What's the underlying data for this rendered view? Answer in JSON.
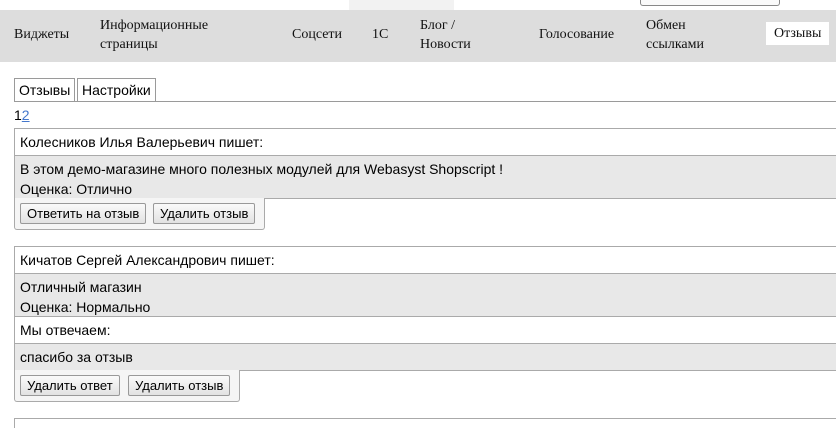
{
  "nav": {
    "items": [
      {
        "label1": "Виджеты",
        "label2": ""
      },
      {
        "label1": "Информационные",
        "label2": "страницы"
      },
      {
        "label1": "Соцсети",
        "label2": ""
      },
      {
        "label1": "1С",
        "label2": ""
      },
      {
        "label1": "Блог /",
        "label2": "Новости"
      },
      {
        "label1": "Голосование",
        "label2": ""
      },
      {
        "label1": "Обмен",
        "label2": "ссылками"
      },
      {
        "label1": "Отзывы",
        "label2": ""
      }
    ],
    "active_index": 7
  },
  "subtabs": [
    "Отзывы",
    "Настройки"
  ],
  "pager": {
    "current": "1",
    "other": "2"
  },
  "reviews": [
    {
      "header": "Колесников Илья Валерьевич пишет:",
      "text": "В этом демо-магазине много полезных модулей для Webasyst Shopscript !",
      "rating": "Оценка: Отлично",
      "buttons": [
        "Ответить на отзыв",
        "Удалить отзыв"
      ]
    },
    {
      "header": "Кичатов Сергей Александрович пишет:",
      "text": "Отличный магазин",
      "rating": "Оценка: Нормально",
      "reply_header": "Мы отвечаем:",
      "reply_text": "спасибо за отзыв",
      "buttons": [
        "Удалить ответ",
        "Удалить отзыв"
      ]
    }
  ],
  "colors": {
    "navbar": "#dddddd",
    "row_gray": "#e8e8e8",
    "link": "#4477cc"
  }
}
